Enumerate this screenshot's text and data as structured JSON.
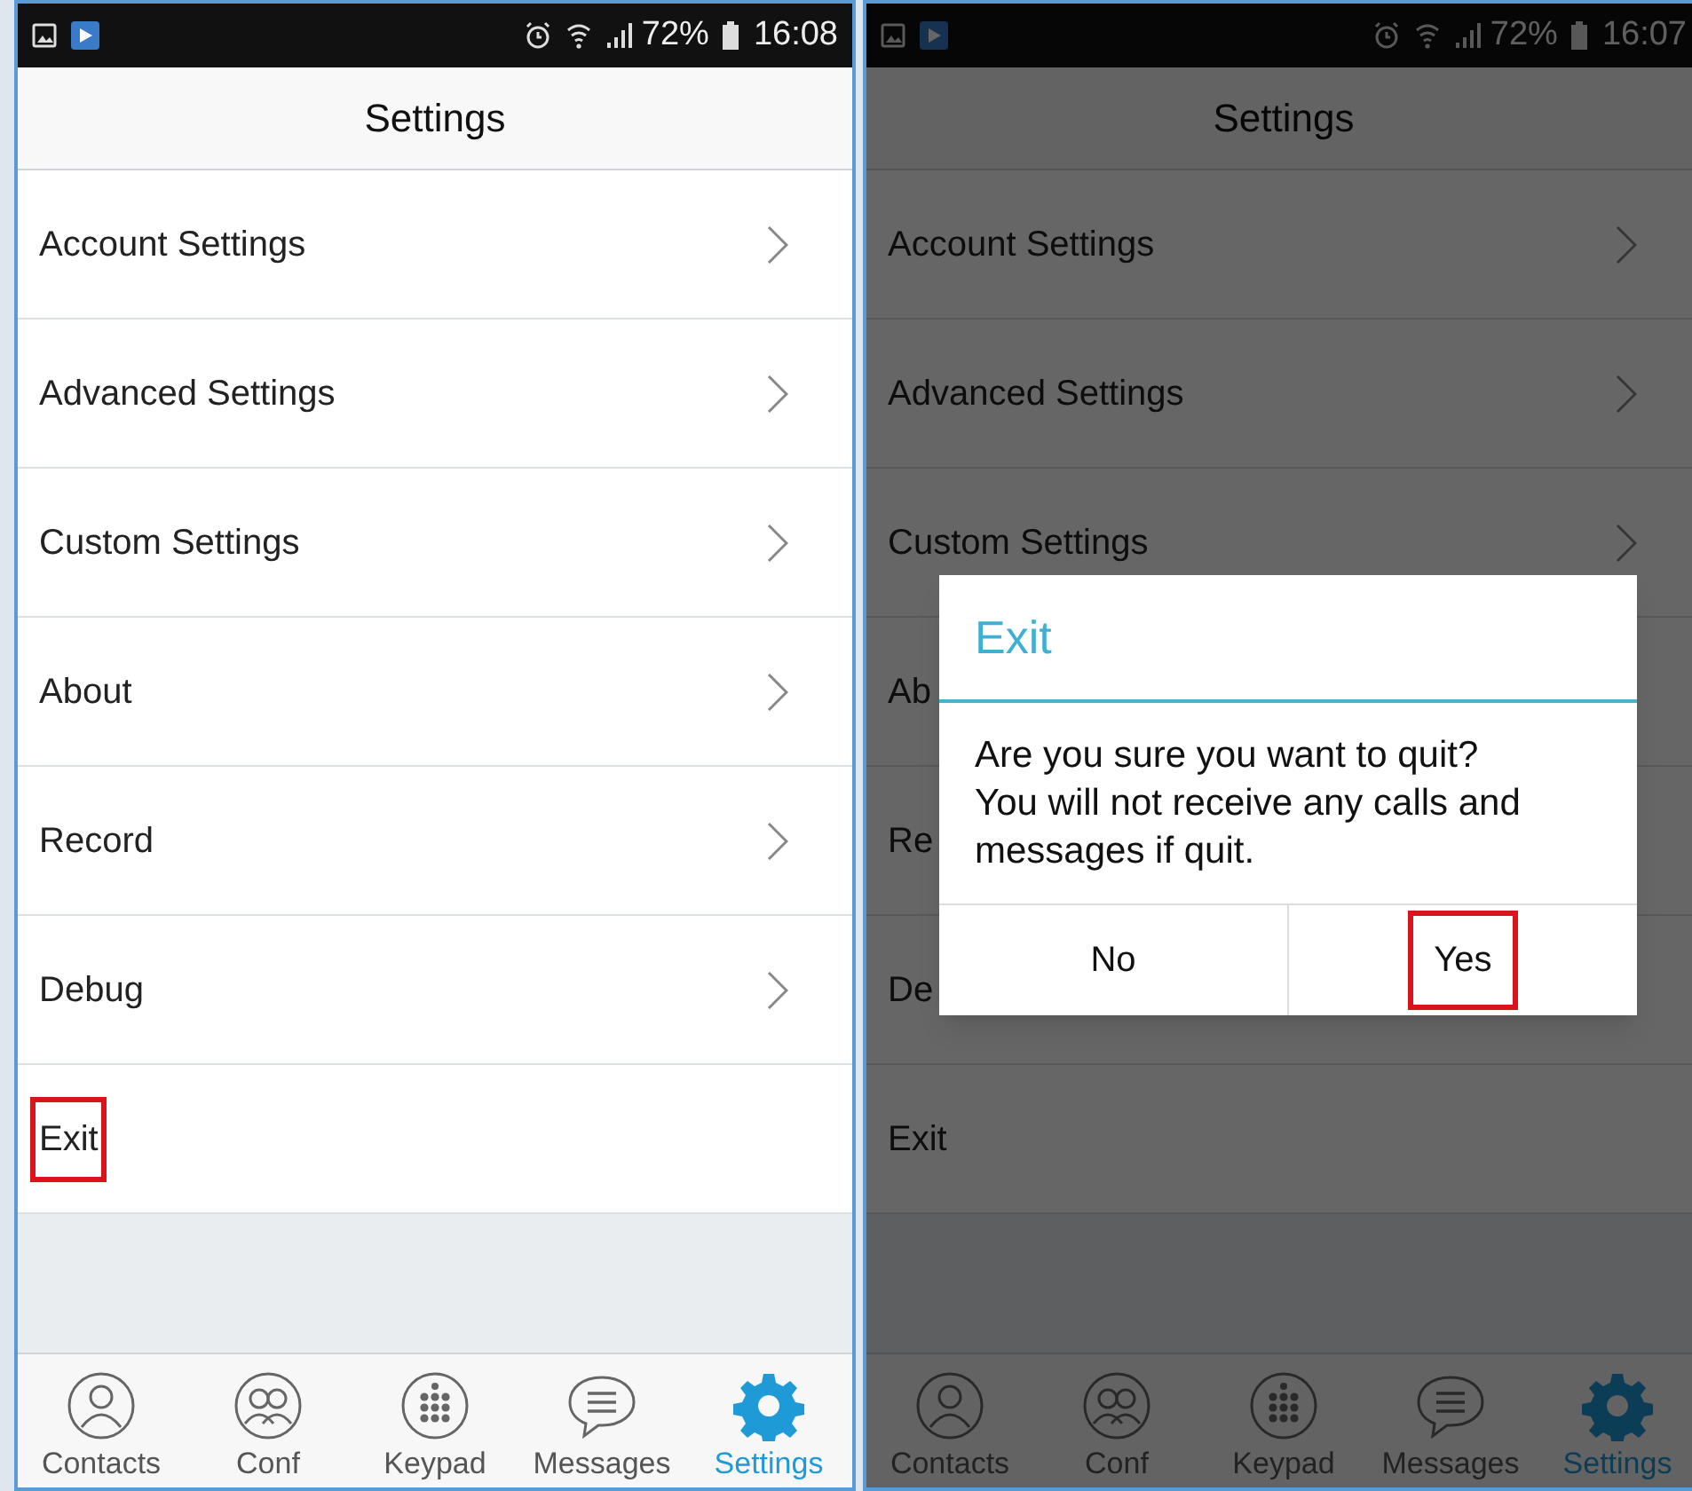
{
  "screens": [
    {
      "status_bar": {
        "battery": "72%",
        "time": "16:08"
      },
      "title": "Settings",
      "rows": [
        {
          "label": "Account Settings",
          "chevron": true,
          "highlighted": false
        },
        {
          "label": "Advanced Settings",
          "chevron": true,
          "highlighted": false
        },
        {
          "label": "Custom Settings",
          "chevron": true,
          "highlighted": false
        },
        {
          "label": "About",
          "chevron": true,
          "highlighted": false
        },
        {
          "label": "Record",
          "chevron": true,
          "highlighted": false
        },
        {
          "label": "Debug",
          "chevron": true,
          "highlighted": false
        },
        {
          "label": "Exit",
          "chevron": false,
          "highlighted": true
        }
      ],
      "tabs": [
        {
          "label": "Contacts",
          "selected": false
        },
        {
          "label": "Conf",
          "selected": false
        },
        {
          "label": "Keypad",
          "selected": false
        },
        {
          "label": "Messages",
          "selected": false
        },
        {
          "label": "Settings",
          "selected": true
        }
      ]
    },
    {
      "status_bar": {
        "battery": "72%",
        "time": "16:07"
      },
      "title": "Settings",
      "rows": [
        {
          "label": "Account Settings",
          "chevron": true,
          "highlighted": false
        },
        {
          "label": "Advanced Settings",
          "chevron": true,
          "highlighted": false
        },
        {
          "label": "Custom Settings",
          "chevron": true,
          "highlighted": false
        },
        {
          "label": "Ab",
          "chevron": false,
          "highlighted": false
        },
        {
          "label": "Re",
          "chevron": false,
          "highlighted": false
        },
        {
          "label": "De",
          "chevron": false,
          "highlighted": false
        },
        {
          "label": "Exit",
          "chevron": false,
          "highlighted": false
        }
      ],
      "tabs": [
        {
          "label": "Contacts",
          "selected": false
        },
        {
          "label": "Conf",
          "selected": false
        },
        {
          "label": "Keypad",
          "selected": false
        },
        {
          "label": "Messages",
          "selected": false
        },
        {
          "label": "Settings",
          "selected": true
        }
      ],
      "dialog": {
        "title": "Exit",
        "message": "Are you sure you want to quit?\nYou will not receive any calls and messages if quit.",
        "buttons": [
          {
            "label": "No",
            "highlighted": false
          },
          {
            "label": "Yes",
            "highlighted": true
          }
        ]
      }
    }
  ]
}
